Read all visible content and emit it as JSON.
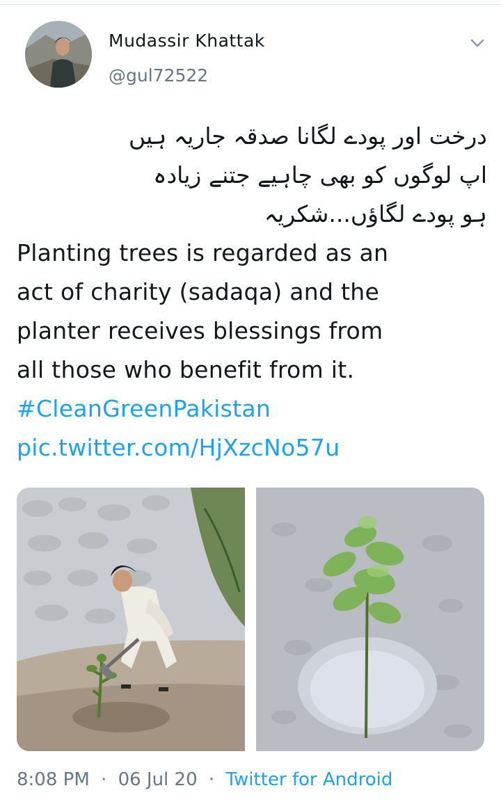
{
  "author": {
    "display_name": "Mudassir Khattak",
    "handle": "@gul72522"
  },
  "tweet": {
    "urdu_lines": [
      "درخت اور پودے لگانا صدقہ جاریہ ہیں",
      "اپ لوگوں کو بھی چاہیے جتنے زیادہ",
      "ہو پودے لگاؤں...شکریہ"
    ],
    "english_lines": [
      "Planting trees is regarded as an",
      "act of charity (sadaqa) and the",
      "planter receives blessings from",
      "all those who benefit from it."
    ],
    "hashtag": "#CleanGreenPakistan",
    "pic_link": "pic.twitter.com/HjXzcNo57u"
  },
  "media": [
    {
      "icon": "photo-man-planting"
    },
    {
      "icon": "photo-sapling"
    }
  ],
  "meta": {
    "time": "8:08 PM",
    "separator": "·",
    "date": "06 Jul 20",
    "source": "Twitter for Android"
  },
  "colors": {
    "link": "#1da1f2",
    "secondary": "#657786",
    "text": "#14171a"
  },
  "icons": {
    "menu": "chevron-down-icon"
  }
}
